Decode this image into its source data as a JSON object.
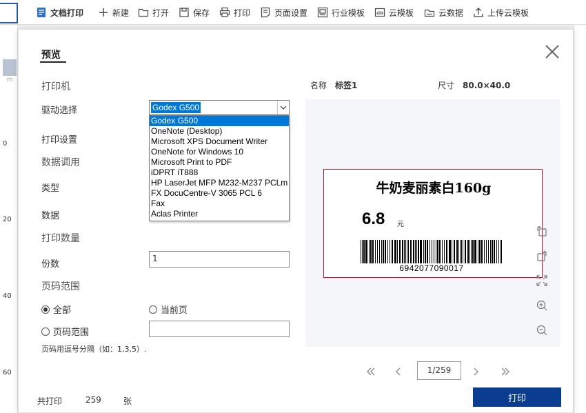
{
  "toolbar": {
    "items": [
      {
        "label": "文档打印",
        "icon": "document-print-icon"
      },
      {
        "label": "新建",
        "icon": "plus-icon"
      },
      {
        "label": "打开",
        "icon": "folder-icon"
      },
      {
        "label": "保存",
        "icon": "save-icon"
      },
      {
        "label": "打印",
        "icon": "printer-icon"
      },
      {
        "label": "页面设置",
        "icon": "page-setup-icon"
      },
      {
        "label": "行业模板",
        "icon": "template-icon"
      },
      {
        "label": "云模板",
        "icon": "cloud-template-icon"
      },
      {
        "label": "云数据",
        "icon": "cloud-data-icon"
      },
      {
        "label": "上传云模板",
        "icon": "upload-icon"
      }
    ]
  },
  "ruler": {
    "marks": [
      "0",
      "20",
      "40",
      "60"
    ],
    "unit": "m"
  },
  "dialog": {
    "title": "预览",
    "printer_section": "打印机",
    "driver_label": "驱动选择",
    "driver_selected": "Godex G500",
    "driver_options": [
      "Godex G500",
      "OneNote (Desktop)",
      "Microsoft XPS Document Writer",
      "OneNote for Windows 10",
      "Microsoft Print to PDF",
      "iDPRT iT888",
      "HP LaserJet MFP M232-M237 PCLm",
      "FX DocuCentre-V 3065 PCL 6",
      "Fax",
      "Aclas Printer"
    ],
    "print_settings_label": "打印设置",
    "data_section": "数据调用",
    "type_label": "类型",
    "data_label": "数据",
    "quantity_section": "打印数量",
    "copies_label": "份数",
    "copies_value": "1",
    "page_range_section": "页码范围",
    "radio_all": "全部",
    "radio_current": "当前页",
    "radio_range": "页码范围",
    "range_value": "",
    "range_hint": "页码用逗号分隔（如：1,3,5）.",
    "name_label": "名称",
    "name_value": "标签1",
    "size_label": "尺寸",
    "size_value": "80.0×40.0",
    "label": {
      "product_name": "牛奶麦丽素白160g",
      "price": "6.8",
      "price_unit": "元",
      "barcode": "6942077090017"
    },
    "page_input": "1/259",
    "total_prefix": "共打印",
    "total_count": "259",
    "total_suffix": "张",
    "print_button": "打印"
  },
  "colors": {
    "accent": "#0a3d8f",
    "selection": "#0078d7",
    "label_border": "#c8102e"
  }
}
